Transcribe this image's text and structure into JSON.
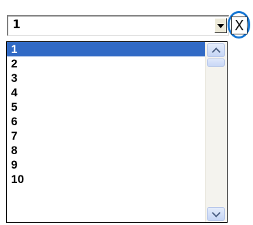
{
  "combo": {
    "selected_value": "1",
    "dropdown_icon": "dropdown-arrow-icon"
  },
  "close_button": {
    "label": "X",
    "highlight_color": "#1576d4"
  },
  "list": {
    "items": [
      "1",
      "2",
      "3",
      "4",
      "5",
      "6",
      "7",
      "8",
      "9",
      "10"
    ],
    "selected_index": 0,
    "selection_color": "#316ac5"
  },
  "scrollbar": {
    "up_icon": "scroll-up-arrow-icon",
    "down_icon": "scroll-down-arrow-icon",
    "position": 0
  }
}
